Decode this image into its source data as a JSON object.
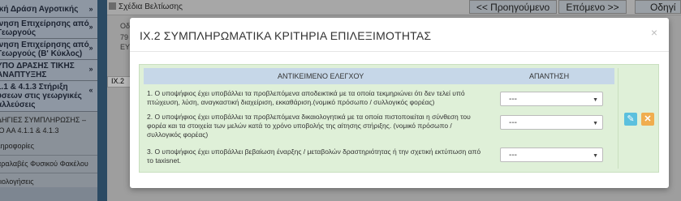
{
  "sidebar": {
    "items": [
      {
        "label": "ική Δράση Αγροτικής"
      },
      {
        "label": "ινηση Επιχείρησης από Γεωργούς"
      },
      {
        "label": "ινηση Επιχείρησης από Γεωργούς (Β' Κύκλος)"
      },
      {
        "label": "ΥΠΟ ΔΡΑΣΗΣ ΤΙΚΗΣ ΑΝΑΠΤΥΞΗΣ"
      },
      {
        "label": "1.1 & 4.1.3 Στήριξη ύσεων στις γεωργικές αλλεύσεις"
      }
    ],
    "subitems": [
      "ΔΗΓΙΕΣ ΣΥΜΠΛΗΡΩΣΗΣ –",
      "ΙΟ ΑΑ 4.1.1 & 4.1.3",
      "ληροφορίες",
      "αραλαβές Φυσικού Φακέλου",
      "ξιολογήσεις"
    ]
  },
  "topbar": {
    "title": "Σχέδια Βελτίωσης",
    "prev_label": "<< Προηγούμενο",
    "next_label": "Επόμενο >>",
    "guide_label": "Οδηγί"
  },
  "background": {
    "field_label": "Οδο",
    "field_value_1": "79",
    "field_value_2": "ΕΥ",
    "tab_label": "ΙΧ.2"
  },
  "modal": {
    "title": "ΙΧ.2 ΣΥΜΠΛΗΡΩΜΑΤΙΚΑ ΚΡΙΤΗΡΙΑ ΕΠΙΛΕΞΙΜΟΤΗΤΑΣ",
    "close": "×",
    "table": {
      "col_subject": "ΑΝΤΙΚΕΙΜΕΝΟ ΕΛΕΓΧΟΥ",
      "col_answer": "ΑΠΑΝΤΗΣΗ",
      "rows": [
        {
          "question": "1. Ο υποψήφιος έχει υποβάλλει τα προβλεπόμενα αποδεικτικά με τα οποία τεκμηριώνει ότι δεν τελεί υπό πτώχευση, λύση, αναγκαστική διαχείριση, εκκαθάριση.(νομικό πρόσωπο / συλλογικός φορέας)",
          "answer": "---"
        },
        {
          "question": "2. Ο υποψήφιος έχει υποβάλλει τα προβλεπόμενα δικαιολογητικά με τα οποία πιστοποιείται η σύνθεση του φορέα και τα στοιχεία των μελών κατά το χρόνο υποβολής της αίτησης στήριξης. (νομικό πρόσωπο / συλλογικός φορέας)",
          "answer": "---"
        },
        {
          "question": "3. Ο υποψήφιος έχει υποβάλλει βεβαίωση έναρξης / μεταβολών δραστηριότητας ή την σχετική εκτύπωση από το taxisnet.",
          "answer": "---"
        }
      ]
    },
    "edit_icon": "edit-icon",
    "delete_icon": "close-icon"
  }
}
